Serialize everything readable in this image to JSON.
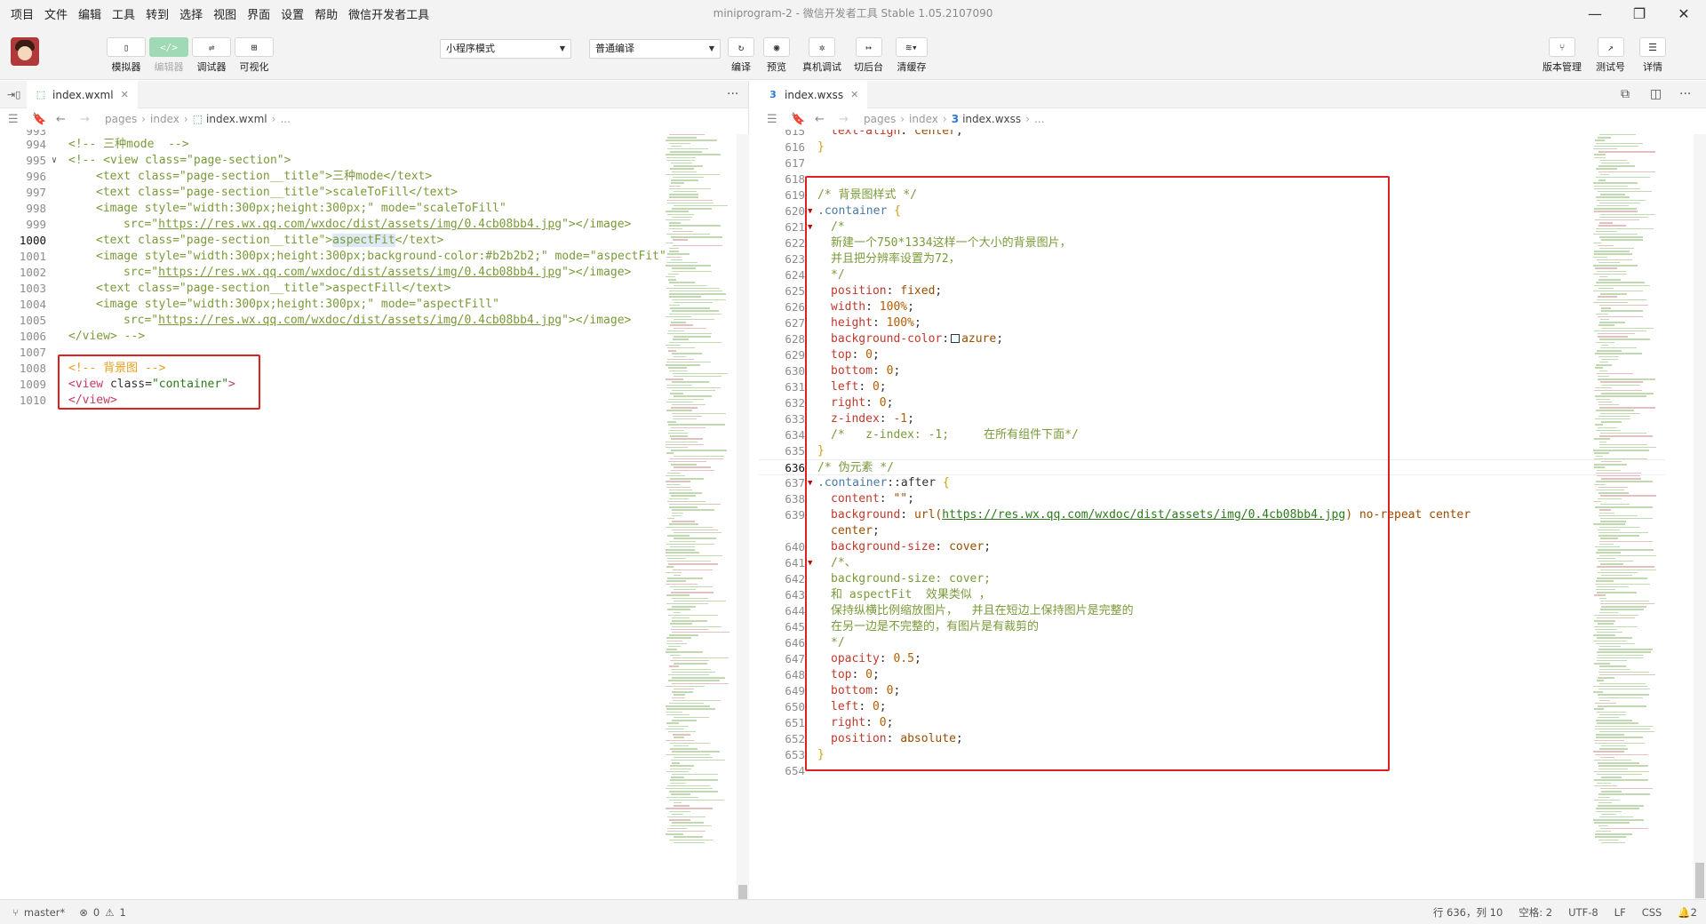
{
  "menubar": {
    "items": [
      "项目",
      "文件",
      "编辑",
      "工具",
      "转到",
      "选择",
      "视图",
      "界面",
      "设置",
      "帮助",
      "微信开发者工具"
    ],
    "title": "miniprogram-2 - 微信开发者工具 Stable 1.05.2107090"
  },
  "toolbar": {
    "simulator": "模拟器",
    "editor": "编辑器",
    "debugger": "调试器",
    "visualize": "可视化",
    "mode_select": "小程序模式",
    "compile_select": "普通编译",
    "compile": "编译",
    "preview": "预览",
    "remote_debug": "真机调试",
    "background": "切后台",
    "clear_cache": "清缓存",
    "version_mgmt": "版本管理",
    "test_account": "测试号",
    "details": "详情"
  },
  "left_editor": {
    "tab": "index.wxml",
    "breadcrumb": [
      "pages",
      "index",
      "index.wxml",
      "..."
    ]
  },
  "right_editor": {
    "tab": "index.wxss",
    "breadcrumb": [
      "pages",
      "index",
      "index.wxss",
      "..."
    ]
  },
  "status": {
    "branch": "master*",
    "errors": "0",
    "warnings": "1",
    "cursor": "行 636，列 10",
    "indent": "空格: 2",
    "encoding": "UTF-8",
    "eol": "LF",
    "language": "CSS",
    "notifications": "2"
  }
}
